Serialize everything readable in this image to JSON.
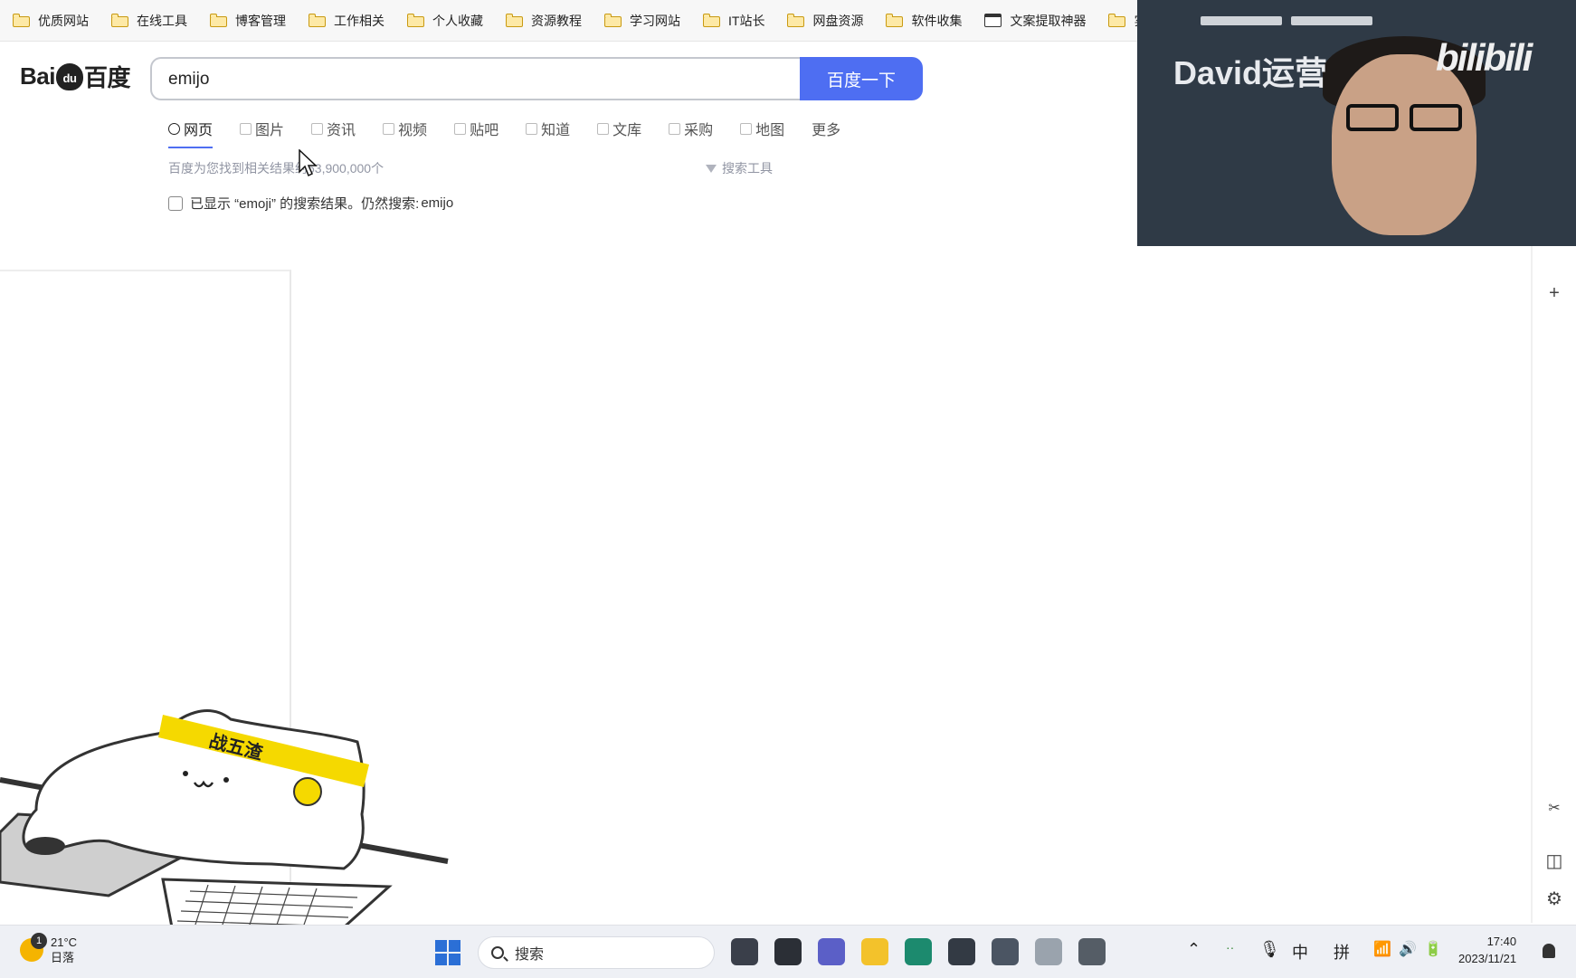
{
  "bookmarks": [
    {
      "label": "优质网站",
      "icon": "folder-icon"
    },
    {
      "label": "在线工具",
      "icon": "folder-icon"
    },
    {
      "label": "博客管理",
      "icon": "folder-icon"
    },
    {
      "label": "工作相关",
      "icon": "folder-icon"
    },
    {
      "label": "个人收藏",
      "icon": "folder-icon"
    },
    {
      "label": "资源教程",
      "icon": "folder-icon"
    },
    {
      "label": "学习网站",
      "icon": "folder-icon"
    },
    {
      "label": "IT站长",
      "icon": "folder-icon"
    },
    {
      "label": "网盘资源",
      "icon": "folder-icon"
    },
    {
      "label": "软件收集",
      "icon": "folder-icon"
    },
    {
      "label": "文案提取神器",
      "icon": "app-icon"
    },
    {
      "label": "实用",
      "icon": "folder-icon"
    }
  ],
  "baidu": {
    "logo_left": "Bai",
    "logo_paw": "du",
    "logo_right": "百度",
    "query": "emijo",
    "search_button": "百度一下",
    "tabs": [
      "网页",
      "图片",
      "资讯",
      "视频",
      "贴吧",
      "知道",
      "文库",
      "采购",
      "地图",
      "更多"
    ],
    "result_count": "百度为您找到相关结果约63,900,000个",
    "search_tools": "搜索工具",
    "correction_prefix": "已显示 “emoji” 的搜索结果。仍然搜索:",
    "correction_link": "emijo"
  },
  "webcam": {
    "name": "David运营",
    "brand": "bilibili"
  },
  "mascot": {
    "headband": "战五渣"
  },
  "rail": {
    "add": "+",
    "split": "◫",
    "settings": "⚙"
  },
  "taskbar": {
    "weather_badge": "1",
    "temperature": "21°C",
    "weather_text": "日落",
    "search_label": "搜索",
    "ime_lang": "中",
    "ime_mode": "拼",
    "time": "17:40",
    "date": "2023/11/21",
    "apps": [
      {
        "name": "app-browser-pre-icon",
        "color": "#3a3f4a"
      },
      {
        "name": "app-task-view-icon",
        "color": "#2b2f36"
      },
      {
        "name": "app-teams-icon",
        "color": "#5b5fc7"
      },
      {
        "name": "app-file-explorer-icon",
        "color": "#f3c22b"
      },
      {
        "name": "app-edge-icon",
        "color": "#1c8a6e"
      },
      {
        "name": "app-store-icon",
        "color": "#333a44"
      },
      {
        "name": "app-notepad-icon",
        "color": "#4b5563"
      },
      {
        "name": "app-image-icon",
        "color": "#9aa3ad"
      },
      {
        "name": "app-phone-link-icon",
        "color": "#555d66"
      }
    ]
  }
}
